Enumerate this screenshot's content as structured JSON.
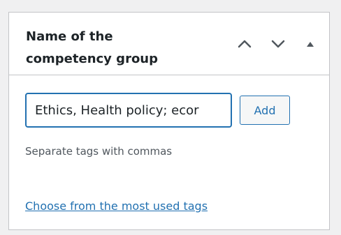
{
  "metabox": {
    "title": "Name of the competency group",
    "controls": {
      "move_up_icon": "chevron-up-icon",
      "move_down_icon": "chevron-down-icon",
      "toggle_icon": "triangle-up-icon"
    },
    "tag_input": {
      "value": "Ethics, Health policy; ecor"
    },
    "add_button_label": "Add",
    "howto_text": "Separate tags with commas",
    "most_used_link_text": "Choose from the most used tags"
  },
  "colors": {
    "accent": "#2271b1",
    "text": "#1d2327",
    "muted_text": "#50575e",
    "border": "#c3c4c7",
    "page_background": "#f0f0f1"
  }
}
